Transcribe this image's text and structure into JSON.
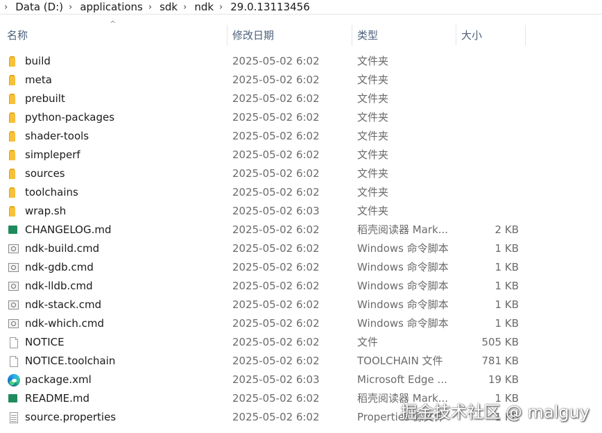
{
  "breadcrumb": {
    "segments": [
      "Data (D:)",
      "applications",
      "sdk",
      "ndk",
      "29.0.13113456"
    ],
    "separator": "›"
  },
  "columns": {
    "name": "名称",
    "date": "修改日期",
    "type": "类型",
    "size": "大小",
    "sort_indicator": "^"
  },
  "files": [
    {
      "icon": "folder-icon",
      "name": "build",
      "date": "2025-05-02 6:02",
      "type": "文件夹",
      "size": ""
    },
    {
      "icon": "folder-icon",
      "name": "meta",
      "date": "2025-05-02 6:02",
      "type": "文件夹",
      "size": ""
    },
    {
      "icon": "folder-icon",
      "name": "prebuilt",
      "date": "2025-05-02 6:02",
      "type": "文件夹",
      "size": ""
    },
    {
      "icon": "folder-icon",
      "name": "python-packages",
      "date": "2025-05-02 6:02",
      "type": "文件夹",
      "size": ""
    },
    {
      "icon": "folder-icon",
      "name": "shader-tools",
      "date": "2025-05-02 6:02",
      "type": "文件夹",
      "size": ""
    },
    {
      "icon": "folder-icon",
      "name": "simpleperf",
      "date": "2025-05-02 6:02",
      "type": "文件夹",
      "size": ""
    },
    {
      "icon": "folder-icon",
      "name": "sources",
      "date": "2025-05-02 6:02",
      "type": "文件夹",
      "size": ""
    },
    {
      "icon": "folder-icon",
      "name": "toolchains",
      "date": "2025-05-02 6:02",
      "type": "文件夹",
      "size": ""
    },
    {
      "icon": "folder-icon",
      "name": "wrap.sh",
      "date": "2025-05-02 6:03",
      "type": "文件夹",
      "size": ""
    },
    {
      "icon": "markdown-file-icon",
      "name": "CHANGELOG.md",
      "date": "2025-05-02 6:02",
      "type": "稻壳阅读器 Mark...",
      "size": "2 KB"
    },
    {
      "icon": "cmd-script-icon",
      "name": "ndk-build.cmd",
      "date": "2025-05-02 6:02",
      "type": "Windows 命令脚本",
      "size": "1 KB"
    },
    {
      "icon": "cmd-script-icon",
      "name": "ndk-gdb.cmd",
      "date": "2025-05-02 6:02",
      "type": "Windows 命令脚本",
      "size": "1 KB"
    },
    {
      "icon": "cmd-script-icon",
      "name": "ndk-lldb.cmd",
      "date": "2025-05-02 6:02",
      "type": "Windows 命令脚本",
      "size": "1 KB"
    },
    {
      "icon": "cmd-script-icon",
      "name": "ndk-stack.cmd",
      "date": "2025-05-02 6:02",
      "type": "Windows 命令脚本",
      "size": "1 KB"
    },
    {
      "icon": "cmd-script-icon",
      "name": "ndk-which.cmd",
      "date": "2025-05-02 6:02",
      "type": "Windows 命令脚本",
      "size": "1 KB"
    },
    {
      "icon": "blank-file-icon",
      "name": "NOTICE",
      "date": "2025-05-02 6:02",
      "type": "文件",
      "size": "505 KB"
    },
    {
      "icon": "blank-file-icon",
      "name": "NOTICE.toolchain",
      "date": "2025-05-02 6:02",
      "type": "TOOLCHAIN 文件",
      "size": "781 KB"
    },
    {
      "icon": "edge-browser-icon",
      "name": "package.xml",
      "date": "2025-05-02 6:03",
      "type": "Microsoft Edge ...",
      "size": "19 KB"
    },
    {
      "icon": "markdown-file-icon",
      "name": "README.md",
      "date": "2025-05-02 6:02",
      "type": "稻壳阅读器 Mark...",
      "size": "1 KB"
    },
    {
      "icon": "properties-file-icon",
      "name": "source.properties",
      "date": "2025-05-02 6:02",
      "type": "Properties 源文件",
      "size": "1 KB"
    }
  ],
  "watermark": "掘金技术社区 @ malguy",
  "colors": {
    "folder": "#f7c13a",
    "markdown": "#1f8a5b",
    "header_text": "#4c607a",
    "secondary_text": "#6a6a6a"
  }
}
